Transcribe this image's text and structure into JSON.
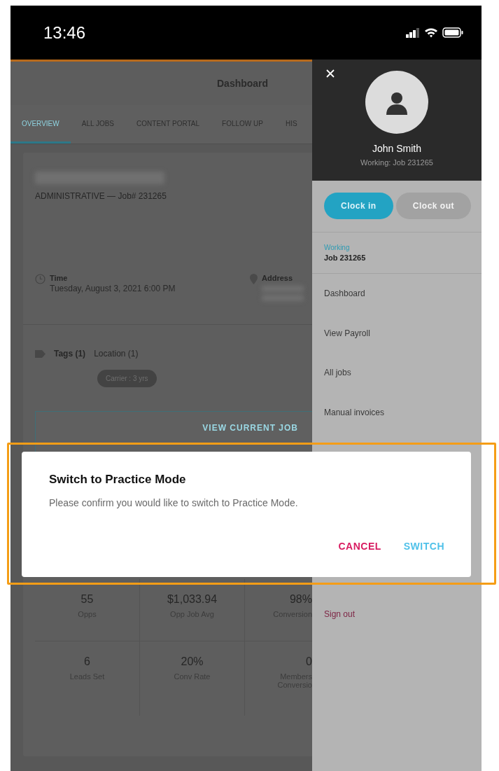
{
  "status_bar": {
    "time": "13:46"
  },
  "header": {
    "title": "Dashboard"
  },
  "tabs": [
    {
      "label": "OVERVIEW",
      "selected": true
    },
    {
      "label": "ALL JOBS",
      "selected": false
    },
    {
      "label": "CONTENT PORTAL",
      "selected": false
    },
    {
      "label": "FOLLOW UP",
      "selected": false
    },
    {
      "label": "HIS",
      "selected": false
    }
  ],
  "job_card": {
    "job_line": "ADMINISTRATIVE — Job# 231265",
    "time_label": "Time",
    "time_value": "Tuesday, August 3, 2021 6:00 PM",
    "address_label": "Address"
  },
  "tag_tabs": [
    {
      "label": "Tags (1)",
      "selected": true
    },
    {
      "label": "Location (1)",
      "selected": false
    }
  ],
  "chips": [
    "Carrier : 3 yrs"
  ],
  "view_job_button": "VIEW CURRENT JOB",
  "stats": [
    {
      "value": "55",
      "label": "Opps"
    },
    {
      "value": "$1,033.94",
      "label": "Opp Job Avg"
    },
    {
      "value": "98%",
      "label": "Conversion"
    },
    {
      "value": "6",
      "label": "Leads Set"
    },
    {
      "value": "20%",
      "label": "Conv Rate"
    },
    {
      "value": "0",
      "label": "Members Conversio"
    }
  ],
  "drawer": {
    "user_name": "John Smith",
    "status": "Working: Job 231265",
    "clock_buttons": [
      {
        "label": "Clock in",
        "disabled": false
      },
      {
        "label": "Clock out",
        "disabled": true
      }
    ],
    "working": {
      "label": "Working",
      "job": "Job 231265"
    },
    "menu": [
      "Dashboard",
      "View Payroll",
      "All jobs",
      "Manual invoices"
    ],
    "sign_out": "Sign out"
  },
  "dialog": {
    "title": "Switch to Practice Mode",
    "message": "Please confirm you would like to switch to Practice Mode.",
    "actions": [
      {
        "label": "CANCEL",
        "kind": "cancel"
      },
      {
        "label": "SWITCH",
        "kind": "confirm"
      }
    ]
  }
}
